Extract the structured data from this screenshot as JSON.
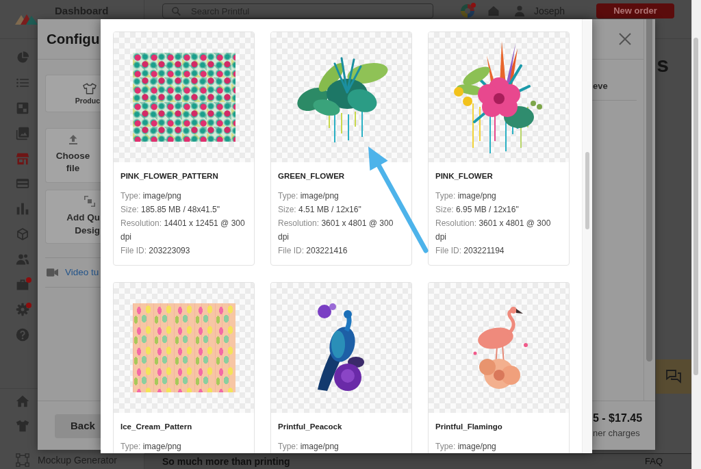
{
  "sidebar": {
    "title": "Dashboard",
    "items": [
      {
        "selected": false,
        "alert": false
      },
      {
        "selected": false,
        "alert": false
      },
      {
        "selected": false,
        "alert": false
      },
      {
        "selected": false,
        "alert": false
      },
      {
        "selected": true,
        "alert": false
      },
      {
        "selected": false,
        "alert": false
      },
      {
        "selected": false,
        "alert": false
      },
      {
        "selected": false,
        "alert": false
      },
      {
        "selected": false,
        "alert": false
      },
      {
        "selected": false,
        "alert": true
      },
      {
        "selected": false,
        "alert": true
      },
      {
        "selected": false,
        "alert": false
      }
    ],
    "bottom_items": [
      {
        "selected": false
      },
      {
        "selected": false
      },
      {
        "selected": false,
        "label": "Mockup Generator"
      }
    ]
  },
  "header": {
    "search": {
      "placeholder": "Search Printful"
    },
    "notification": true,
    "user": "Joseph",
    "new_order": "New order"
  },
  "page": {
    "heading": "s",
    "footer": {
      "tagline": "So much more than printing",
      "faq": "FAQ"
    }
  },
  "configure_modal": {
    "title": "Configu",
    "options": [
      {
        "lines": [
          "Produc"
        ]
      },
      {
        "lines": [
          "Choose",
          "file"
        ]
      },
      {
        "lines": [
          "Add Qu",
          "Desig"
        ]
      }
    ],
    "video_link": "Video tu",
    "back_button": "Back",
    "side_label": "eve",
    "price": "5 - $17.45",
    "price_note": "ner charges"
  },
  "file_picker": {
    "files": [
      {
        "name": "PINK_FLOWER_PATTERN",
        "details": [
          {
            "label": "Type:",
            "value": "image/png"
          },
          {
            "label": "Size:",
            "value": "185.85 MB / 48x41.5\""
          },
          {
            "label": "Resolution:",
            "value": "14401 x 12451 @ 300 dpi"
          },
          {
            "label": "File ID:",
            "value": "203223093"
          }
        ]
      },
      {
        "name": "GREEN_FLOWER",
        "details": [
          {
            "label": "Type:",
            "value": "image/png"
          },
          {
            "label": "Size:",
            "value": "4.51 MB / 12x16\""
          },
          {
            "label": "Resolution:",
            "value": "3601 x 4801 @ 300 dpi"
          },
          {
            "label": "File ID:",
            "value": "203221416"
          }
        ]
      },
      {
        "name": "PINK_FLOWER",
        "details": [
          {
            "label": "Type:",
            "value": "image/png"
          },
          {
            "label": "Size:",
            "value": "6.95 MB / 12x16\""
          },
          {
            "label": "Resolution:",
            "value": "3601 x 4801 @ 300 dpi"
          },
          {
            "label": "File ID:",
            "value": "203221194"
          }
        ]
      },
      {
        "name": "Ice_Cream_Pattern",
        "details": [
          {
            "label": "Type:",
            "value": "image/png"
          }
        ]
      },
      {
        "name": "Printful_Peacock",
        "details": [
          {
            "label": "Type:",
            "value": "image/png"
          }
        ]
      },
      {
        "name": "Printful_Flamingo",
        "details": [
          {
            "label": "Type:",
            "value": "image/png"
          }
        ]
      }
    ]
  },
  "annotations": [
    {
      "kind": "arrow"
    }
  ]
}
